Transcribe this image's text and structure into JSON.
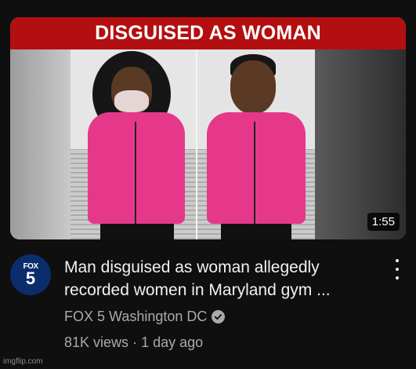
{
  "thumbnail": {
    "banner_text": "DISGUISED AS WOMAN",
    "duration": "1:55",
    "banner_color": "#b30f10"
  },
  "channel_avatar": {
    "top_text": "FOX",
    "number": "5",
    "background": "#0b2d6d"
  },
  "video": {
    "title": "Man disguised as woman allegedly recorded women in Maryland gym ...",
    "channel_name": "FOX 5 Washington DC",
    "views": "81K views",
    "separator": "·",
    "age": "1 day ago"
  },
  "icons": {
    "verified": "checkmark-circle-icon",
    "more": "vertical-ellipsis-icon"
  },
  "watermark": "imgflip.com"
}
